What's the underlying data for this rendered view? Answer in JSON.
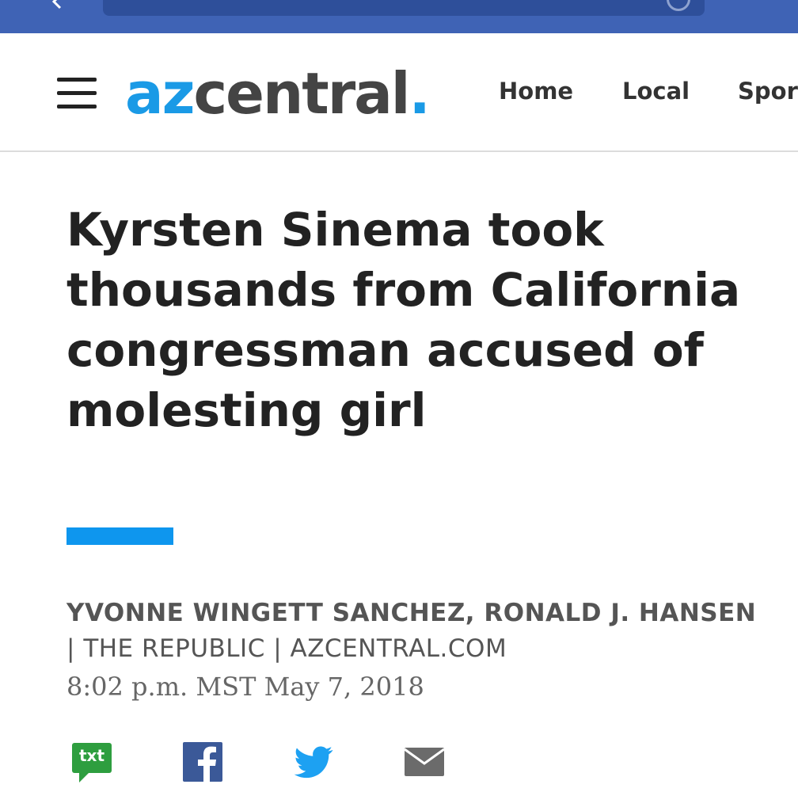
{
  "site": {
    "logo_part1": "az",
    "logo_part2": "central",
    "logo_dot": ".",
    "nav": [
      "Home",
      "Local",
      "Sport"
    ]
  },
  "article": {
    "headline": "Kyrsten Sinema took thousands from California congressman accused of molesting girl",
    "authors": "YVONNE WINGETT SANCHEZ, RONALD J. HANSEN",
    "separator": "|",
    "source": "THE REPUBLIC | AZCENTRAL.COM",
    "timestamp": "8:02 p.m. MST May 7, 2018"
  },
  "share": {
    "txt_label": "txt",
    "icons": [
      "sms-txt-icon",
      "facebook-icon",
      "twitter-icon",
      "email-icon"
    ]
  },
  "colors": {
    "browser_bar": "#3f63b5",
    "brand_blue": "#1a9ae6",
    "accent": "#0e96ee",
    "facebook": "#3b5998",
    "twitter": "#1da1f2",
    "sms_green": "#2e9e3f"
  }
}
